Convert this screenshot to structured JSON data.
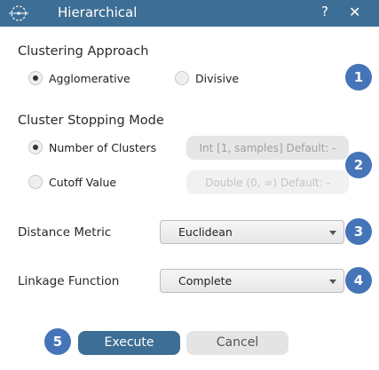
{
  "window": {
    "title": "Hierarchical",
    "help_label": "?",
    "close_label": "✕",
    "logo_icon": "compass-logo-icon"
  },
  "clustering": {
    "heading": "Clustering Approach",
    "options": [
      {
        "label": "Agglomerative",
        "selected": true
      },
      {
        "label": "Divisive",
        "selected": false
      }
    ],
    "badge": "1"
  },
  "stopping": {
    "heading": "Cluster Stopping Mode",
    "options": [
      {
        "label": "Number of Clusters",
        "selected": true,
        "placeholder": "Int [1, samples] Default: -"
      },
      {
        "label": "Cutoff Value",
        "selected": false,
        "placeholder": "Double (0, ∞) Default: -"
      }
    ],
    "badge": "2"
  },
  "distance": {
    "label": "Distance Metric",
    "value": "Euclidean",
    "badge": "3"
  },
  "linkage": {
    "label": "Linkage Function",
    "value": "Complete",
    "badge": "4"
  },
  "actions": {
    "badge": "5",
    "execute_label": "Execute",
    "cancel_label": "Cancel"
  },
  "colors": {
    "titlebar": "#3d6e95",
    "badge": "#4574b8",
    "primary_button": "#3d6e95"
  }
}
